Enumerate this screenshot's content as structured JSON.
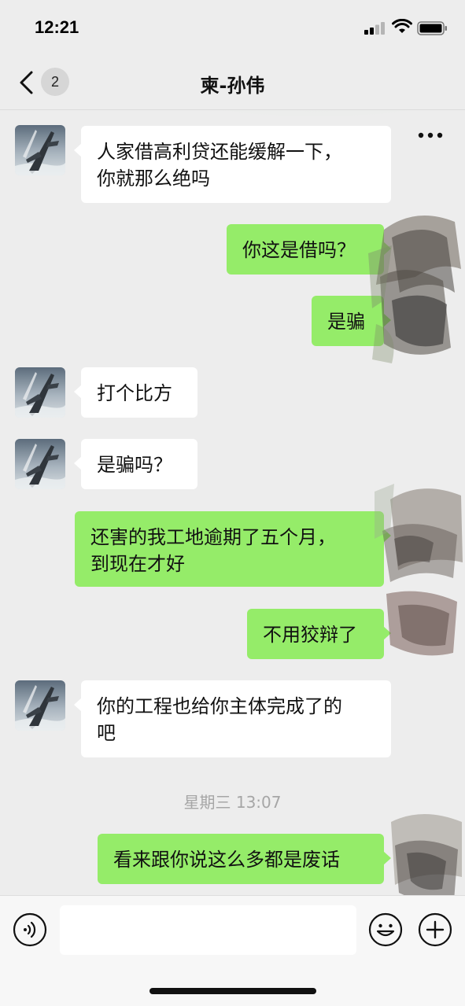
{
  "status_bar": {
    "time": "12:21"
  },
  "nav": {
    "unread_count": "2",
    "title": "柬-孙伟"
  },
  "messages": [
    {
      "side": "in",
      "lines": [
        "人家借高利贷还能缓解一下，",
        "你就那么绝吗"
      ]
    },
    {
      "side": "out",
      "lines": [
        "你这是借吗？"
      ]
    },
    {
      "side": "out",
      "lines": [
        "是骗"
      ]
    },
    {
      "side": "in",
      "lines": [
        "打个比方"
      ]
    },
    {
      "side": "in",
      "lines": [
        "是骗吗？"
      ]
    },
    {
      "side": "out",
      "lines": [
        "还害的我工地逾期了五个月，",
        "到现在才好"
      ]
    },
    {
      "side": "out",
      "lines": [
        "不用狡辩了"
      ]
    },
    {
      "side": "in",
      "lines": [
        "你的工程也给你主体完成了的",
        "吧"
      ]
    },
    {
      "side": "out",
      "lines": [
        "看来跟你说这么多都是废话"
      ]
    }
  ],
  "timestamp": "星期三 13:07",
  "input": {
    "placeholder": ""
  },
  "icons": {
    "back": "chevron-left-icon",
    "more": "more-icon",
    "voice": "voice-icon",
    "emoji": "emoji-icon",
    "plus": "plus-icon"
  },
  "colors": {
    "outgoing_bubble": "#95ec69",
    "incoming_bubble": "#ffffff",
    "background": "#ededed"
  }
}
